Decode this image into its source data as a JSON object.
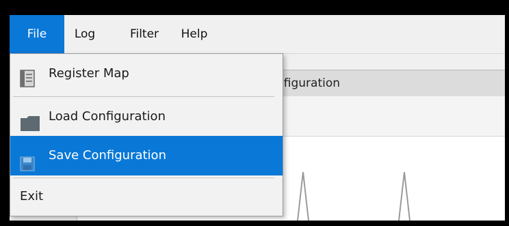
{
  "menubar": {
    "items": [
      {
        "label": "File",
        "active": true
      },
      {
        "label": "Log",
        "active": false
      },
      {
        "label": "Filter",
        "active": false
      },
      {
        "label": "Help",
        "active": false
      }
    ]
  },
  "background_tab": {
    "label": "nfiguration"
  },
  "file_menu": {
    "items": [
      {
        "label": "Register Map",
        "icon": "register-map-icon"
      },
      {
        "label": "Load Configuration",
        "icon": "folder-icon"
      },
      {
        "label": "Save Configuration",
        "icon": "floppy-disk-icon",
        "highlighted": true
      },
      {
        "label": "Exit"
      }
    ]
  },
  "colors": {
    "accent": "#0a78d7",
    "menu_background": "#f2f2f2"
  }
}
